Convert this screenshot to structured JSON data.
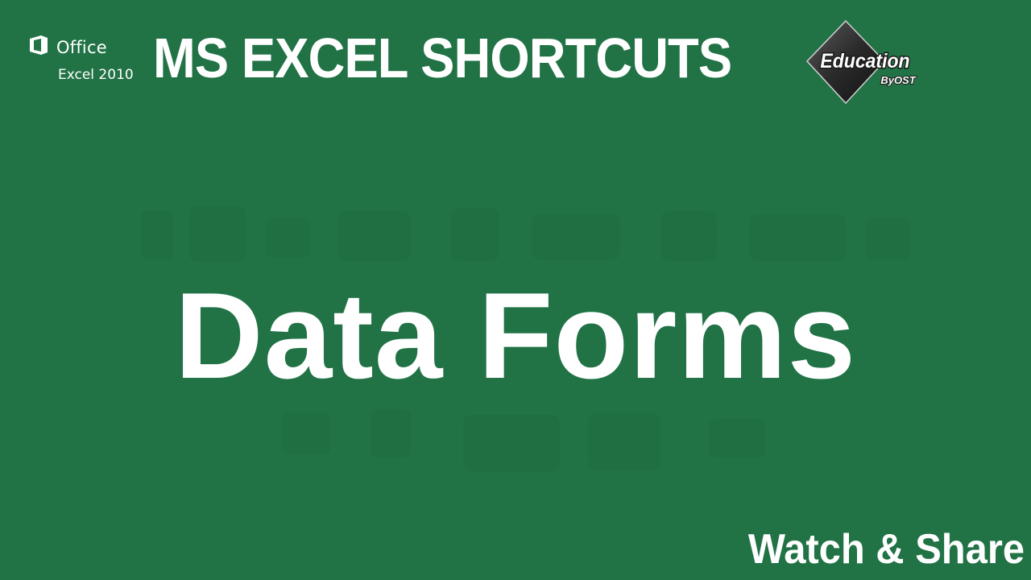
{
  "office_brand": {
    "office_label": "Office",
    "product_label": "Excel 2010",
    "icon": "office-logo-icon"
  },
  "headline": "MS EXCEL SHORTCUTS",
  "badge": {
    "primary": "Education",
    "secondary": "ByOST",
    "icon": "diamond-badge-icon"
  },
  "topic": "Data Forms",
  "cta": "Watch & Share",
  "colors": {
    "background": "#217346",
    "text": "#ffffff",
    "badge_dark": "#2b2b2b"
  }
}
